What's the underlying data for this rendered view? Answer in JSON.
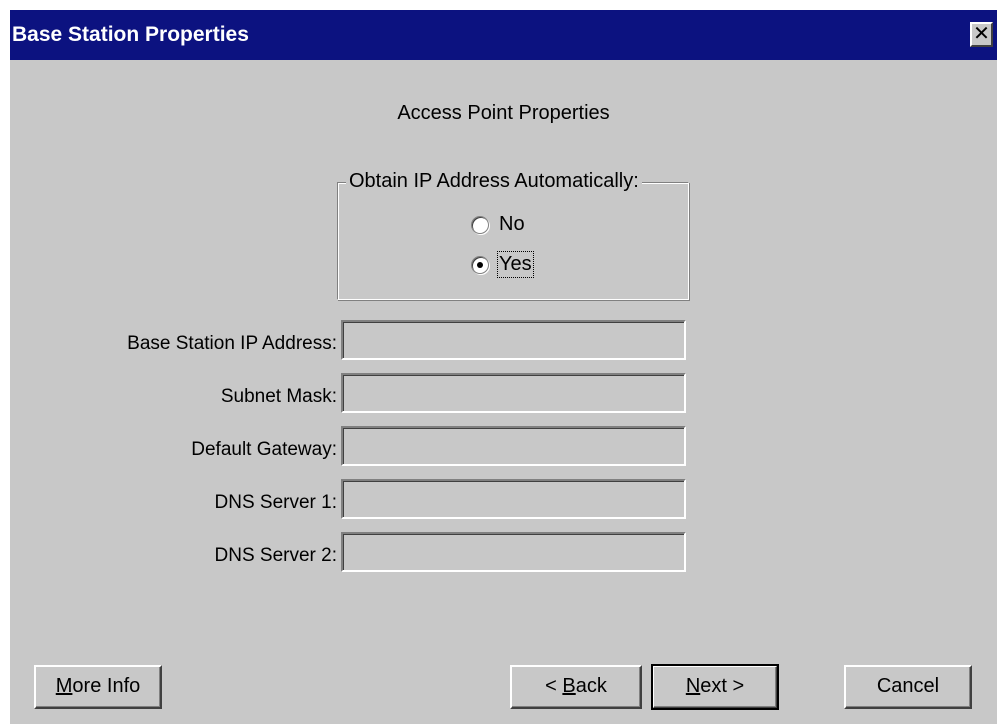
{
  "window": {
    "title": "Base Station Properties",
    "close_glyph": "✕"
  },
  "heading": "Access Point Properties",
  "ip_group": {
    "legend": "Obtain IP Address Automatically:",
    "options": [
      {
        "label": "No",
        "checked": false
      },
      {
        "label": "Yes",
        "checked": true
      }
    ]
  },
  "fields": [
    {
      "label": "Base Station IP Address:",
      "value": ""
    },
    {
      "label": "Subnet Mask:",
      "value": ""
    },
    {
      "label": "Default Gateway:",
      "value": ""
    },
    {
      "label": "DNS Server 1:",
      "value": ""
    },
    {
      "label": "DNS Server 2:",
      "value": ""
    }
  ],
  "buttons": {
    "more_info_mnemonic": "M",
    "more_info_rest": "ore Info",
    "back_prefix": "< ",
    "back_mnemonic": "B",
    "back_rest": "ack",
    "next_mnemonic": "N",
    "next_rest": "ext >",
    "cancel": "Cancel"
  },
  "colors": {
    "titlebar": "#0c1280",
    "dialog_bg": "#c8c8c8"
  },
  "icons": {
    "close": "close-icon"
  }
}
